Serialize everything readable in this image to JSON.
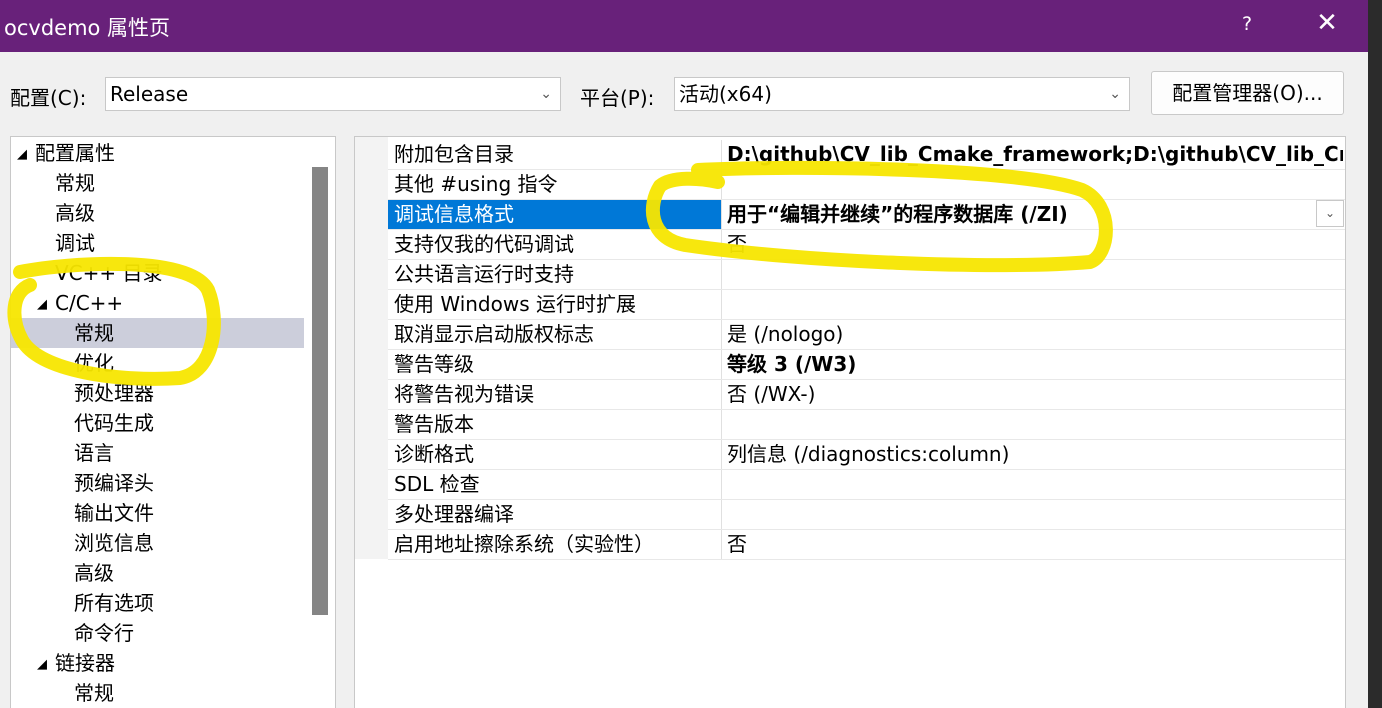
{
  "colors": {
    "title_bar": "#68217a",
    "selection": "#0078d7",
    "tree_selection": "#cccedb",
    "highlight_marker": "#f7e600"
  },
  "dialog": {
    "title": "ocvdemo 属性页",
    "help": "?",
    "close": "✕"
  },
  "toolbar": {
    "config_label": "配置(C):",
    "config_value": "Release",
    "platform_label": "平台(P):",
    "platform_value": "活动(x64)",
    "manager_button": "配置管理器(O)..."
  },
  "tree": {
    "items": [
      {
        "label": "配置属性",
        "expander": "◢"
      },
      {
        "label": "常规"
      },
      {
        "label": "高级"
      },
      {
        "label": "调试"
      },
      {
        "label": "VC++ 目录"
      },
      {
        "label": "C/C++",
        "expander": "◢"
      },
      {
        "label": "常规",
        "selected": true
      },
      {
        "label": "优化"
      },
      {
        "label": "预处理器"
      },
      {
        "label": "代码生成"
      },
      {
        "label": "语言"
      },
      {
        "label": "预编译头"
      },
      {
        "label": "输出文件"
      },
      {
        "label": "浏览信息"
      },
      {
        "label": "高级"
      },
      {
        "label": "所有选项"
      },
      {
        "label": "命令行"
      },
      {
        "label": "链接器",
        "expander": "◢"
      },
      {
        "label": "常规"
      }
    ]
  },
  "properties": {
    "rows": [
      {
        "name": "附加包含目录",
        "value": "D:\\github\\CV_lib_Cmake_framework;D:\\github\\CV_lib_Cmake",
        "bold": true
      },
      {
        "name": "其他 #using 指令",
        "value": ""
      },
      {
        "name": "调试信息格式",
        "value": "用于“编辑并继续”的程序数据库 (/ZI)",
        "bold": true,
        "selected": true
      },
      {
        "name": "支持仅我的代码调试",
        "value": "否"
      },
      {
        "name": "公共语言运行时支持",
        "value": ""
      },
      {
        "name": "使用 Windows 运行时扩展",
        "value": ""
      },
      {
        "name": "取消显示启动版权标志",
        "value": "是 (/nologo)"
      },
      {
        "name": "警告等级",
        "value": "等级 3 (/W3)",
        "bold": true
      },
      {
        "name": "将警告视为错误",
        "value": "否 (/WX-)"
      },
      {
        "name": "警告版本",
        "value": ""
      },
      {
        "name": "诊断格式",
        "value": "列信息 (/diagnostics:column)"
      },
      {
        "name": "SDL 检查",
        "value": ""
      },
      {
        "name": "多处理器编译",
        "value": ""
      },
      {
        "name": "启用地址擦除系统（实验性）",
        "value": "否"
      }
    ]
  }
}
